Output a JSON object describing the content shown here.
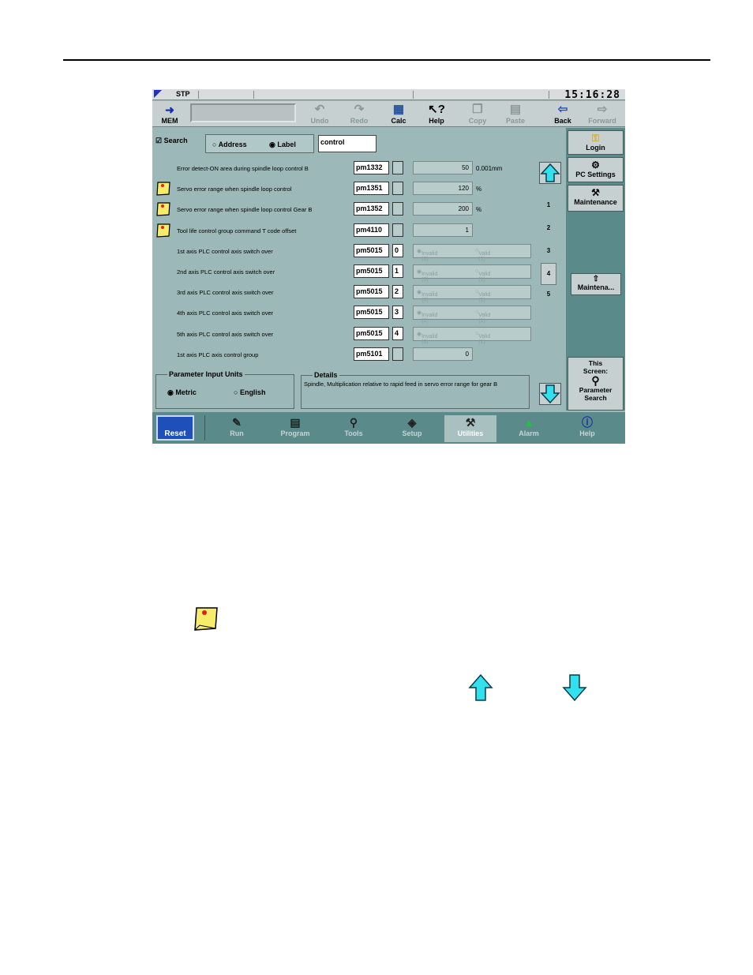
{
  "status": {
    "mode": "STP",
    "clock": "15:16:28"
  },
  "toolbar": {
    "mem": "MEM",
    "undo": "Undo",
    "redo": "Redo",
    "calc": "Calc",
    "help": "Help",
    "copy": "Copy",
    "paste": "Paste",
    "back": "Back",
    "forward": "Forward"
  },
  "search": {
    "checkbox": "Search",
    "address": "Address",
    "label": "Label",
    "value": "control",
    "address_selected": false,
    "label_selected": true
  },
  "rows": [
    {
      "desc": "Error detect-ON area during spindle loop control B",
      "param": "pm1332",
      "bit": "",
      "value": "50",
      "unit": "0.001mm",
      "note": false,
      "type": "value"
    },
    {
      "desc": "Servo error range when spindle loop control",
      "param": "pm1351",
      "bit": "",
      "value": "120",
      "unit": "%",
      "note": true,
      "type": "value"
    },
    {
      "desc": "Servo error range when spindle loop control Gear B",
      "param": "pm1352",
      "bit": "",
      "value": "200",
      "unit": "%",
      "note": true,
      "type": "value"
    },
    {
      "desc": "Tool life control group command T code offset",
      "param": "pm4110",
      "bit": "",
      "value": "1",
      "unit": "",
      "note": true,
      "type": "value"
    },
    {
      "desc": "1st axis PLC control axis switch over",
      "param": "pm5015",
      "bit": "0",
      "opt_a": "Invalid (0)",
      "opt_b": "Valid (1)",
      "note": false,
      "type": "radio"
    },
    {
      "desc": "2nd axis PLC control axis switch over",
      "param": "pm5015",
      "bit": "1",
      "opt_a": "Invalid (0)",
      "opt_b": "Valid (1)",
      "note": false,
      "type": "radio"
    },
    {
      "desc": "3rd axis PLC control axis switch over",
      "param": "pm5015",
      "bit": "2",
      "opt_a": "Invalid (0)",
      "opt_b": "Valid (1)",
      "note": false,
      "type": "radio"
    },
    {
      "desc": "4th axis PLC control axis switch over",
      "param": "pm5015",
      "bit": "3",
      "opt_a": "Invalid (0)",
      "opt_b": "Valid (1)",
      "note": false,
      "type": "radio"
    },
    {
      "desc": "5th axis PLC control axis switch over",
      "param": "pm5015",
      "bit": "4",
      "opt_a": "Invalid (0)",
      "opt_b": "Valid (1)",
      "note": false,
      "type": "radio"
    },
    {
      "desc": "1st axis PLC axis control group",
      "param": "pm5101",
      "bit": "",
      "value": "0",
      "unit": "",
      "note": false,
      "type": "value"
    }
  ],
  "pages": [
    "1",
    "2",
    "3",
    "4",
    "5"
  ],
  "selected_page": "4",
  "units": {
    "title": "Parameter Input Units",
    "metric": "Metric",
    "english": "English",
    "metric_selected": true
  },
  "details": {
    "title": "Details",
    "text": "Spindle, Multiplication relative to rapid feed in servo error range for gear B"
  },
  "right_panel": {
    "login": "Login",
    "pc_settings": "PC Settings",
    "maintenance": "Maintenance",
    "maintena": "Maintena...",
    "this_screen_1": "This",
    "this_screen_2": "Screen:",
    "param_search_1": "Parameter",
    "param_search_2": "Search"
  },
  "bottom": {
    "reset": "Reset",
    "run": "Run",
    "program": "Program",
    "tools": "Tools",
    "setup": "Setup",
    "utilities": "Utilities",
    "alarm": "Alarm",
    "help": "Help",
    "selected": "Utilities"
  },
  "colors": {
    "accent": "#1f4fb8",
    "arrow": "#33e0ee",
    "note": "#f6ec6a",
    "panel": "#9cb8b8"
  }
}
